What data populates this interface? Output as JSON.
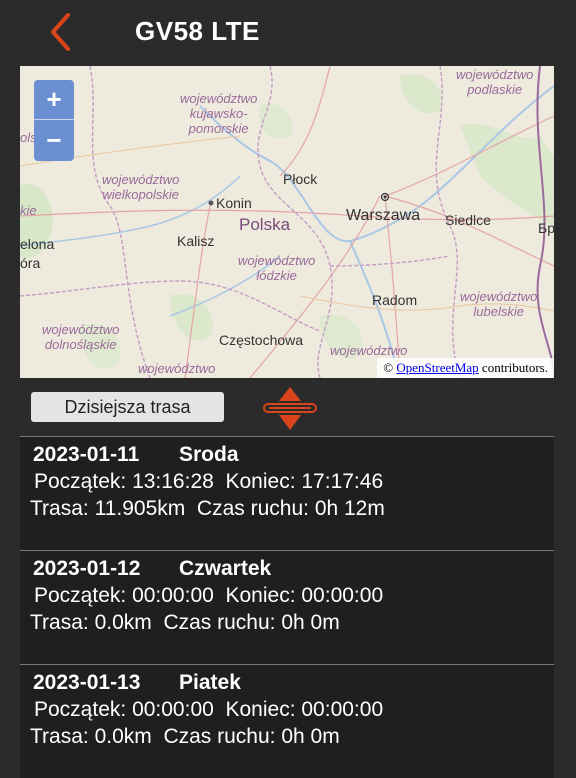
{
  "header": {
    "title": "GV58 LTE",
    "back_icon": "chevron-left-icon"
  },
  "map": {
    "zoom_in": "+",
    "zoom_out": "−",
    "labels": {
      "woj_podlaskie": "województwo\npodlaskie",
      "woj_kujawsko": "województwo\nkujawsko-\npomorskie",
      "woj_wielkopolskie": "województwo\nwielkopolskie",
      "woj_lodzkie": "województwo\nłódzkie",
      "woj_lubelskie": "województwo\nlubelskie",
      "woj_dolnoslaskie": "województwo\ndolnośląskie",
      "woj_bottom_left": "województwo",
      "woj_bottom_right": "województwo",
      "edge_olski": "olski",
      "edge_kie": "kie",
      "edge_elona": "elona",
      "edge_ora": "óra",
      "edge_br": "Бр",
      "plock": "Płock",
      "konin": "Konin",
      "polska": "Polska",
      "warszawa": "Warszawa",
      "siedlce": "Siedlce",
      "kalisz": "Kalisz",
      "radom": "Radom",
      "czestochowa": "Częstochowa"
    },
    "attribution_prefix": "©",
    "attribution_link": "OpenStreetMap",
    "attribution_suffix": "contributors."
  },
  "controls": {
    "today_route_label": "Dzisiejsza trasa",
    "expand_icon": "expand-collapse-icon",
    "accent": "#d9441c"
  },
  "routes": [
    {
      "date": "2023-01-11",
      "day": "Sroda",
      "start_label": "Początek:",
      "start": "13:16:28",
      "end_label": "Koniec:",
      "end": "17:17:46",
      "route_label": "Trasa:",
      "distance": "11.905km",
      "motion_label": "Czas ruchu:",
      "motion": "0h 12m"
    },
    {
      "date": "2023-01-12",
      "day": "Czwartek",
      "start_label": "Początek:",
      "start": "00:00:00",
      "end_label": "Koniec:",
      "end": "00:00:00",
      "route_label": "Trasa:",
      "distance": "0.0km",
      "motion_label": "Czas ruchu:",
      "motion": "0h 0m"
    },
    {
      "date": "2023-01-13",
      "day": "Piatek",
      "start_label": "Początek:",
      "start": "00:00:00",
      "end_label": "Koniec:",
      "end": "00:00:00",
      "route_label": "Trasa:",
      "distance": "0.0km",
      "motion_label": "Czas ruchu:",
      "motion": "0h 0m"
    }
  ]
}
